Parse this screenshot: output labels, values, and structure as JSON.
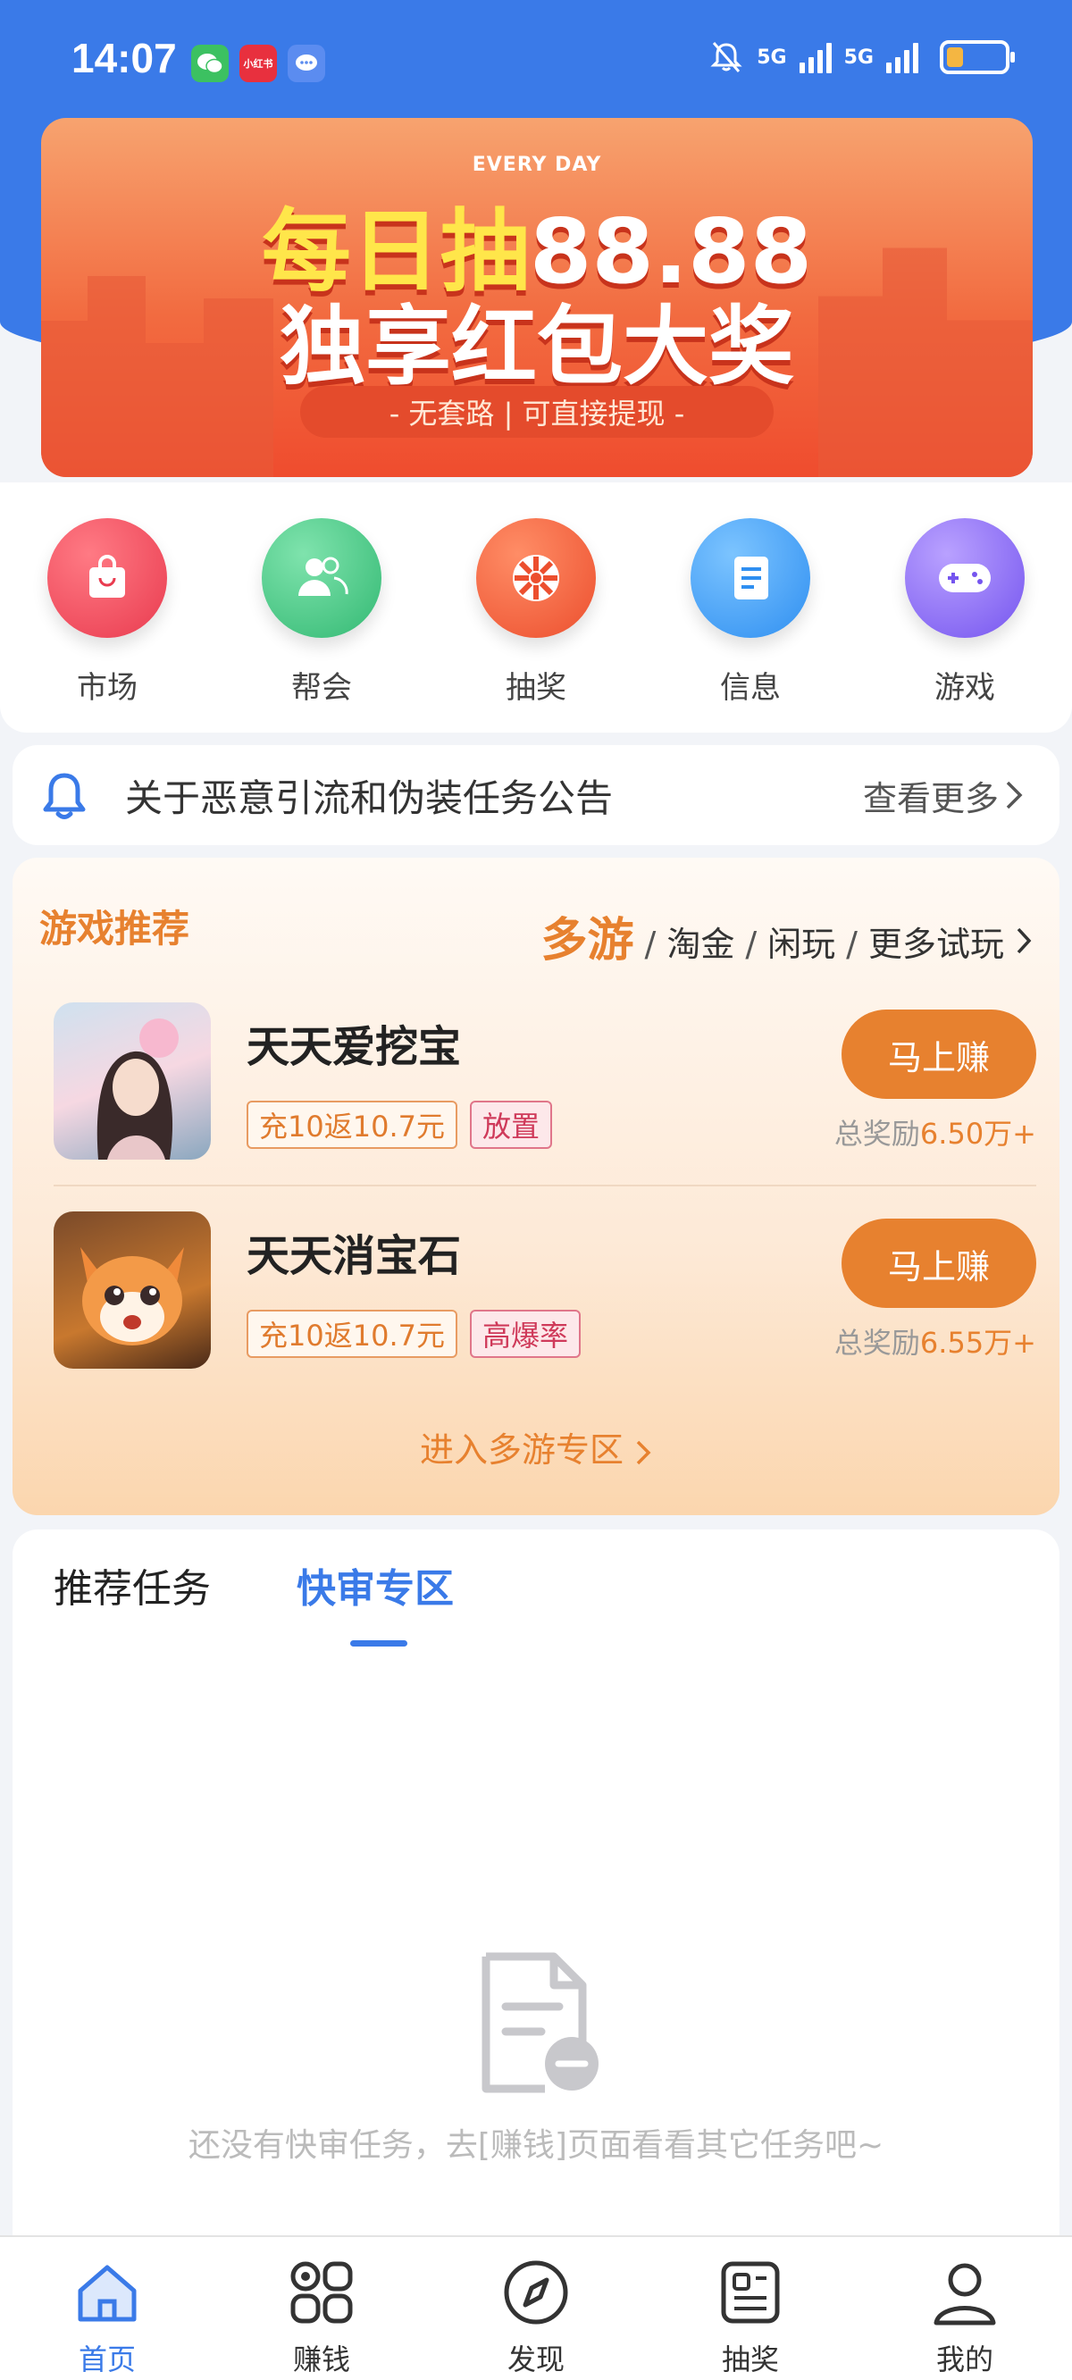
{
  "status_bar": {
    "time": "14:07",
    "notification_icons": [
      "wechat-icon",
      "xiaohongshu-icon",
      "message-icon"
    ],
    "xiaohongshu_label": "小红书",
    "signal_labels": [
      "5G",
      "5G"
    ]
  },
  "banner": {
    "top_text": "EVERY DAY",
    "line1_prefix": "每日抽",
    "line1_amount": "88.88",
    "line2": "独享红包大奖",
    "pill": "- 无套路 | 可直接提现 -"
  },
  "quick_nav": [
    {
      "label": "市场",
      "icon": "shopping-bag-icon",
      "color": "#ef4a5a"
    },
    {
      "label": "帮会",
      "icon": "users-icon",
      "color": "#44c985"
    },
    {
      "label": "抽奖",
      "icon": "wheel-icon",
      "color": "#f0603c"
    },
    {
      "label": "信息",
      "icon": "document-icon",
      "color": "#3d9ff3"
    },
    {
      "label": "游戏",
      "icon": "gamepad-icon",
      "color": "#8a6ff2"
    }
  ],
  "notice": {
    "text": "关于恶意引流和伪装任务公告",
    "more": "查看更多"
  },
  "games": {
    "title": "游戏推荐",
    "links": [
      "多游",
      "淘金",
      "闲玩",
      "更多试玩"
    ],
    "items": [
      {
        "name": "天天爱挖宝",
        "tag1": "充10返10.7元",
        "tag2": "放置",
        "button": "马上赚",
        "reward_prefix": "总奖励",
        "reward_value": "6.50万+"
      },
      {
        "name": "天天消宝石",
        "tag1": "充10返10.7元",
        "tag2": "高爆率",
        "button": "马上赚",
        "reward_prefix": "总奖励",
        "reward_value": "6.55万+"
      }
    ],
    "enter_zone": "进入多游专区"
  },
  "tasks": {
    "tabs": [
      "推荐任务",
      "快审专区"
    ],
    "active_tab": "快审专区",
    "empty_text": "还没有快审任务，去[赚钱]页面看看其它任务吧~"
  },
  "bottom_nav": [
    {
      "label": "首页",
      "icon": "home-icon",
      "active": true
    },
    {
      "label": "赚钱",
      "icon": "grid-icon",
      "active": false
    },
    {
      "label": "发现",
      "icon": "compass-icon",
      "active": false
    },
    {
      "label": "抽奖",
      "icon": "ticket-icon",
      "active": false
    },
    {
      "label": "我的",
      "icon": "person-icon",
      "active": false
    }
  ],
  "colors": {
    "primary": "#3a7ae8",
    "accent": "#e7812f"
  }
}
